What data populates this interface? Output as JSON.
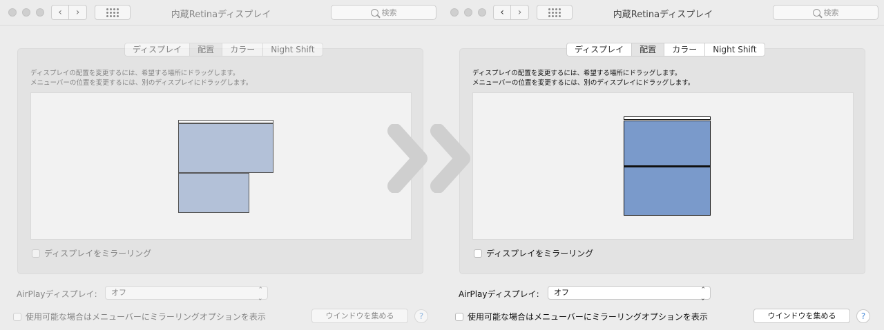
{
  "window": {
    "title": "内蔵Retinaディスプレイ",
    "search_placeholder": "検索",
    "nav_back": "‹",
    "nav_forward": "›"
  },
  "tabs": [
    {
      "label": "ディスプレイ",
      "selected": false
    },
    {
      "label": "配置",
      "selected": true
    },
    {
      "label": "カラー",
      "selected": false
    },
    {
      "label": "Night Shift",
      "selected": false
    }
  ],
  "description": {
    "line1": "ディスプレイの配置を変更するには、希望する場所にドラッグします。",
    "line2": "メニューバーの位置を変更するには、別のディスプレイにドラッグします。"
  },
  "mirror_label": "ディスプレイをミラーリング",
  "airplay": {
    "label": "AirPlayディスプレイ:",
    "value": "オフ"
  },
  "show_mirror_options_label": "使用可能な場合はメニューバーにミラーリングオプションを表示",
  "gather_windows_label": "ウインドウを集める",
  "help_label": "?",
  "colors": {
    "display_before": "#b3c1d8",
    "display_after": "#7a9acb",
    "arrow": "#d2d2d2"
  }
}
